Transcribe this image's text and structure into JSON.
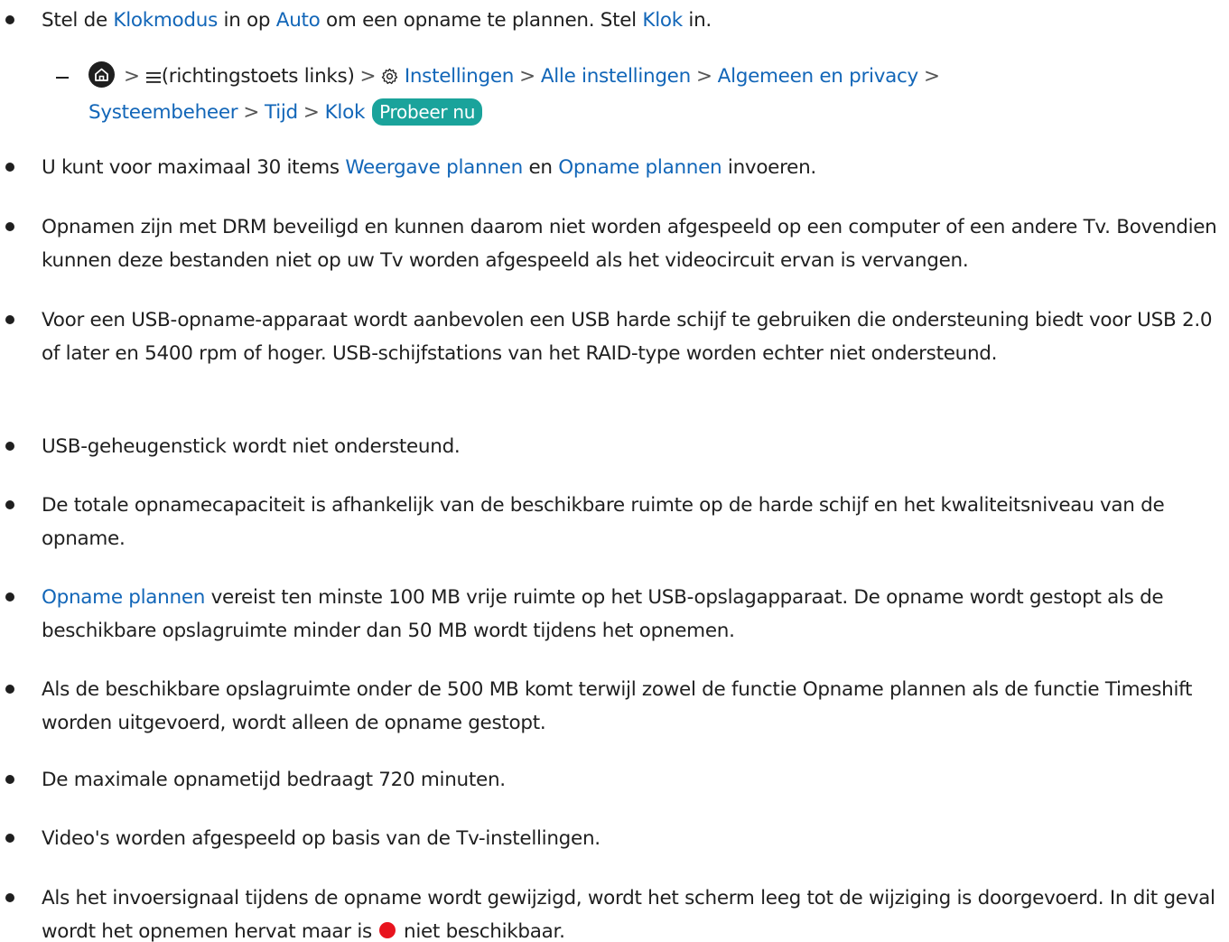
{
  "items": [
    {
      "parts": [
        {
          "t": "Stel de "
        },
        {
          "t": "Klokmodus",
          "link": true
        },
        {
          "t": " in op "
        },
        {
          "t": "Auto",
          "link": true
        },
        {
          "t": " om een opname te plannen. Stel "
        },
        {
          "t": "Klok",
          "link": true
        },
        {
          "t": " in."
        }
      ]
    },
    {
      "parts": [
        {
          "t": "U kunt voor maximaal 30 items "
        },
        {
          "t": "Weergave plannen",
          "link": true
        },
        {
          "t": " en "
        },
        {
          "t": "Opname plannen",
          "link": true
        },
        {
          "t": " invoeren."
        }
      ]
    },
    {
      "parts": [
        {
          "t": "Opnamen zijn met DRM beveiligd en kunnen daarom niet worden afgespeeld op een computer of een andere Tv. Bovendien kunnen deze bestanden niet op uw Tv worden afgespeeld als het videocircuit ervan is vervangen."
        }
      ]
    },
    {
      "parts": [
        {
          "t": "Voor een USB-opname-apparaat wordt aanbevolen een USB harde schijf te gebruiken die ondersteuning biedt voor USB 2.0 of later en 5400 rpm of hoger. USB-schijfstations van het RAID-type worden echter niet ondersteund."
        }
      ]
    },
    {
      "parts": [
        {
          "t": "USB-geheugenstick wordt niet ondersteund."
        }
      ]
    },
    {
      "parts": [
        {
          "t": "De totale opnamecapaciteit is afhankelijk van de beschikbare ruimte op de harde schijf en het kwaliteitsniveau van de opname."
        }
      ]
    },
    {
      "parts": [
        {
          "t": "Opname plannen",
          "link": true
        },
        {
          "t": " vereist ten minste 100 MB vrije ruimte op het USB-opslagapparaat. De opname wordt gestopt als de beschikbare opslagruimte minder dan 50 MB wordt tijdens het opnemen."
        }
      ]
    },
    {
      "parts": [
        {
          "t": "Als de beschikbare opslagruimte onder de 500 MB komt terwijl zowel de functie Opname plannen als de functie Timeshift worden uitgevoerd, wordt alleen de opname gestopt."
        }
      ]
    },
    {
      "parts": [
        {
          "t": "De maximale opnametijd bedraagt 720 minuten."
        }
      ]
    },
    {
      "parts": [
        {
          "t": "Video's worden afgespeeld op basis van de Tv-instellingen."
        }
      ]
    },
    {
      "parts": [
        {
          "t": "Als het invoersignaal tijdens de opname wordt gewijzigd, wordt het scherm leeg tot de wijziging is doorgevoerd. In dit geval wordt het opnemen hervat maar is "
        },
        {
          "icon": "record-dot-icon"
        },
        {
          "t": " niet beschikbaar."
        }
      ]
    }
  ],
  "path": {
    "menu_note": "(richtingstoets links)",
    "steps": [
      "Instellingen",
      "Alle instellingen",
      "Algemeen en privacy",
      "Systeembeheer",
      "Tijd",
      "Klok"
    ],
    "try_label": "Probeer nu",
    "home_icon": "home-icon",
    "menu_icon": "menu-icon",
    "settings_icon": "gear-icon",
    "separator": ">"
  },
  "colors": {
    "link": "#1266b8",
    "badge": "#1aa39b",
    "record": "#e8141e",
    "text": "#1f1f1f"
  }
}
